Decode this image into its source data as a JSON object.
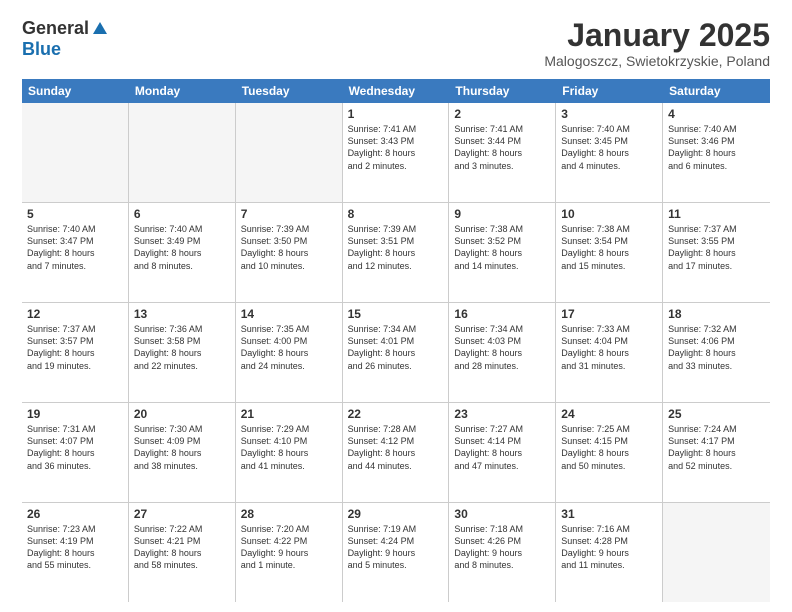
{
  "logo": {
    "general": "General",
    "blue": "Blue"
  },
  "title": "January 2025",
  "subtitle": "Malogoszcz, Swietokrzyskie, Poland",
  "days": [
    "Sunday",
    "Monday",
    "Tuesday",
    "Wednesday",
    "Thursday",
    "Friday",
    "Saturday"
  ],
  "rows": [
    [
      {
        "day": "",
        "info": "",
        "empty": true
      },
      {
        "day": "",
        "info": "",
        "empty": true
      },
      {
        "day": "",
        "info": "",
        "empty": true
      },
      {
        "day": "1",
        "info": "Sunrise: 7:41 AM\nSunset: 3:43 PM\nDaylight: 8 hours\nand 2 minutes."
      },
      {
        "day": "2",
        "info": "Sunrise: 7:41 AM\nSunset: 3:44 PM\nDaylight: 8 hours\nand 3 minutes."
      },
      {
        "day": "3",
        "info": "Sunrise: 7:40 AM\nSunset: 3:45 PM\nDaylight: 8 hours\nand 4 minutes."
      },
      {
        "day": "4",
        "info": "Sunrise: 7:40 AM\nSunset: 3:46 PM\nDaylight: 8 hours\nand 6 minutes."
      }
    ],
    [
      {
        "day": "5",
        "info": "Sunrise: 7:40 AM\nSunset: 3:47 PM\nDaylight: 8 hours\nand 7 minutes."
      },
      {
        "day": "6",
        "info": "Sunrise: 7:40 AM\nSunset: 3:49 PM\nDaylight: 8 hours\nand 8 minutes."
      },
      {
        "day": "7",
        "info": "Sunrise: 7:39 AM\nSunset: 3:50 PM\nDaylight: 8 hours\nand 10 minutes."
      },
      {
        "day": "8",
        "info": "Sunrise: 7:39 AM\nSunset: 3:51 PM\nDaylight: 8 hours\nand 12 minutes."
      },
      {
        "day": "9",
        "info": "Sunrise: 7:38 AM\nSunset: 3:52 PM\nDaylight: 8 hours\nand 14 minutes."
      },
      {
        "day": "10",
        "info": "Sunrise: 7:38 AM\nSunset: 3:54 PM\nDaylight: 8 hours\nand 15 minutes."
      },
      {
        "day": "11",
        "info": "Sunrise: 7:37 AM\nSunset: 3:55 PM\nDaylight: 8 hours\nand 17 minutes."
      }
    ],
    [
      {
        "day": "12",
        "info": "Sunrise: 7:37 AM\nSunset: 3:57 PM\nDaylight: 8 hours\nand 19 minutes."
      },
      {
        "day": "13",
        "info": "Sunrise: 7:36 AM\nSunset: 3:58 PM\nDaylight: 8 hours\nand 22 minutes."
      },
      {
        "day": "14",
        "info": "Sunrise: 7:35 AM\nSunset: 4:00 PM\nDaylight: 8 hours\nand 24 minutes."
      },
      {
        "day": "15",
        "info": "Sunrise: 7:34 AM\nSunset: 4:01 PM\nDaylight: 8 hours\nand 26 minutes."
      },
      {
        "day": "16",
        "info": "Sunrise: 7:34 AM\nSunset: 4:03 PM\nDaylight: 8 hours\nand 28 minutes."
      },
      {
        "day": "17",
        "info": "Sunrise: 7:33 AM\nSunset: 4:04 PM\nDaylight: 8 hours\nand 31 minutes."
      },
      {
        "day": "18",
        "info": "Sunrise: 7:32 AM\nSunset: 4:06 PM\nDaylight: 8 hours\nand 33 minutes."
      }
    ],
    [
      {
        "day": "19",
        "info": "Sunrise: 7:31 AM\nSunset: 4:07 PM\nDaylight: 8 hours\nand 36 minutes."
      },
      {
        "day": "20",
        "info": "Sunrise: 7:30 AM\nSunset: 4:09 PM\nDaylight: 8 hours\nand 38 minutes."
      },
      {
        "day": "21",
        "info": "Sunrise: 7:29 AM\nSunset: 4:10 PM\nDaylight: 8 hours\nand 41 minutes."
      },
      {
        "day": "22",
        "info": "Sunrise: 7:28 AM\nSunset: 4:12 PM\nDaylight: 8 hours\nand 44 minutes."
      },
      {
        "day": "23",
        "info": "Sunrise: 7:27 AM\nSunset: 4:14 PM\nDaylight: 8 hours\nand 47 minutes."
      },
      {
        "day": "24",
        "info": "Sunrise: 7:25 AM\nSunset: 4:15 PM\nDaylight: 8 hours\nand 50 minutes."
      },
      {
        "day": "25",
        "info": "Sunrise: 7:24 AM\nSunset: 4:17 PM\nDaylight: 8 hours\nand 52 minutes."
      }
    ],
    [
      {
        "day": "26",
        "info": "Sunrise: 7:23 AM\nSunset: 4:19 PM\nDaylight: 8 hours\nand 55 minutes."
      },
      {
        "day": "27",
        "info": "Sunrise: 7:22 AM\nSunset: 4:21 PM\nDaylight: 8 hours\nand 58 minutes."
      },
      {
        "day": "28",
        "info": "Sunrise: 7:20 AM\nSunset: 4:22 PM\nDaylight: 9 hours\nand 1 minute."
      },
      {
        "day": "29",
        "info": "Sunrise: 7:19 AM\nSunset: 4:24 PM\nDaylight: 9 hours\nand 5 minutes."
      },
      {
        "day": "30",
        "info": "Sunrise: 7:18 AM\nSunset: 4:26 PM\nDaylight: 9 hours\nand 8 minutes."
      },
      {
        "day": "31",
        "info": "Sunrise: 7:16 AM\nSunset: 4:28 PM\nDaylight: 9 hours\nand 11 minutes."
      },
      {
        "day": "",
        "info": "",
        "empty": true
      }
    ]
  ]
}
